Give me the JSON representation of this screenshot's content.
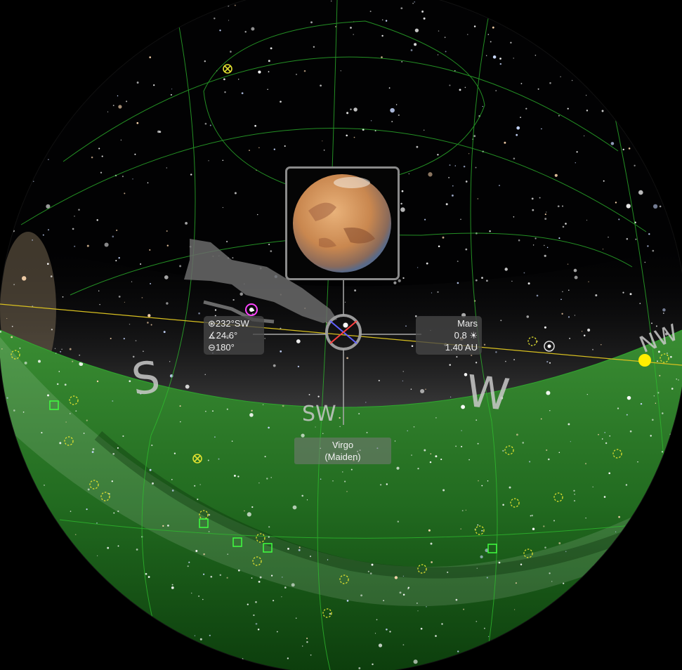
{
  "app": {
    "kind": "planetarium-sky-view"
  },
  "colors": {
    "ground": "#1f7a1f",
    "grid": "#2fbf2f",
    "ecliptic": "#d8c020",
    "sun": "#ffee00",
    "selection_ring": "#9a9a9a",
    "marker_yellow": "#e0e030",
    "marker_green": "#40ff40",
    "marker_magenta": "#ff44ff"
  },
  "compass": {
    "south": "S",
    "southwest": "SW",
    "west": "W",
    "northwest": "NW"
  },
  "selected_object": {
    "name": "Mars",
    "magnitude": "0.8",
    "distance": "1.40 AU",
    "azimuth": "232°SW",
    "altitude": "24.6°",
    "field": "180°"
  },
  "constellation": {
    "name": "Virgo",
    "subtitle": "(Maiden)"
  },
  "icons": {
    "azimuth": "compass-icon",
    "altitude": "angle-icon",
    "field": "field-of-view-icon",
    "magnitude": "brightness-icon"
  }
}
